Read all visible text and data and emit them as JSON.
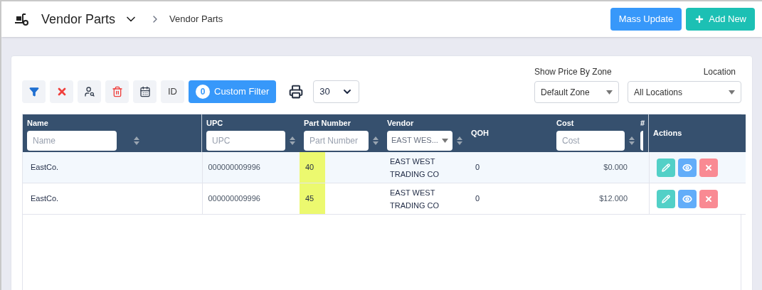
{
  "header": {
    "title": "Vendor Parts",
    "breadcrumb": "Vendor Parts",
    "buttons": [
      {
        "label": "Mass Update",
        "kind": "primary"
      },
      {
        "label": "Add New",
        "kind": "add"
      }
    ]
  },
  "toolbar": {
    "tools": [
      {
        "kind": "filter"
      },
      {
        "kind": "clear"
      },
      {
        "kind": "spy"
      },
      {
        "kind": "delete"
      },
      {
        "kind": "calendar"
      },
      {
        "kind": "id",
        "label": "ID"
      }
    ],
    "custom_filter": {
      "count": "0",
      "label": "Custom Filter"
    },
    "page_size": "30"
  },
  "zone": {
    "label": "Show Price By Zone",
    "value": "Default Zone"
  },
  "location": {
    "label": "Location",
    "value": "All Locations"
  },
  "table": {
    "columns": [
      {
        "label": "Name",
        "kind": "input",
        "placeholder": "Name",
        "sort": true
      },
      {
        "label": "UPC",
        "kind": "input",
        "placeholder": "UPC",
        "sort": true
      },
      {
        "label": "Part Number",
        "kind": "input",
        "placeholder": "Part Number",
        "sort": true
      },
      {
        "label": "Vendor",
        "kind": "select",
        "value": "EAST WES...",
        "sort": true
      },
      {
        "label": "QOH",
        "kind": "plain",
        "sort": false
      },
      {
        "label": "Cost",
        "kind": "input",
        "placeholder": "Cost",
        "sort": true
      },
      {
        "label": "#",
        "kind": "stub",
        "sort": false
      },
      {
        "label": "Actions",
        "kind": "plain",
        "sort": false
      }
    ],
    "rows": [
      {
        "name": "EastCo.",
        "upc": "000000009996",
        "part_number": "40",
        "highlighted": true,
        "vendor": "EAST WEST TRADING CO",
        "qoh": "0",
        "cost": "$0.000",
        "selected": true
      },
      {
        "name": "EastCo.",
        "upc": "000000009996",
        "part_number": "45",
        "highlighted": true,
        "vendor": "EAST WEST TRADING CO",
        "qoh": "0",
        "cost": "$12.000",
        "selected": false
      }
    ]
  }
}
